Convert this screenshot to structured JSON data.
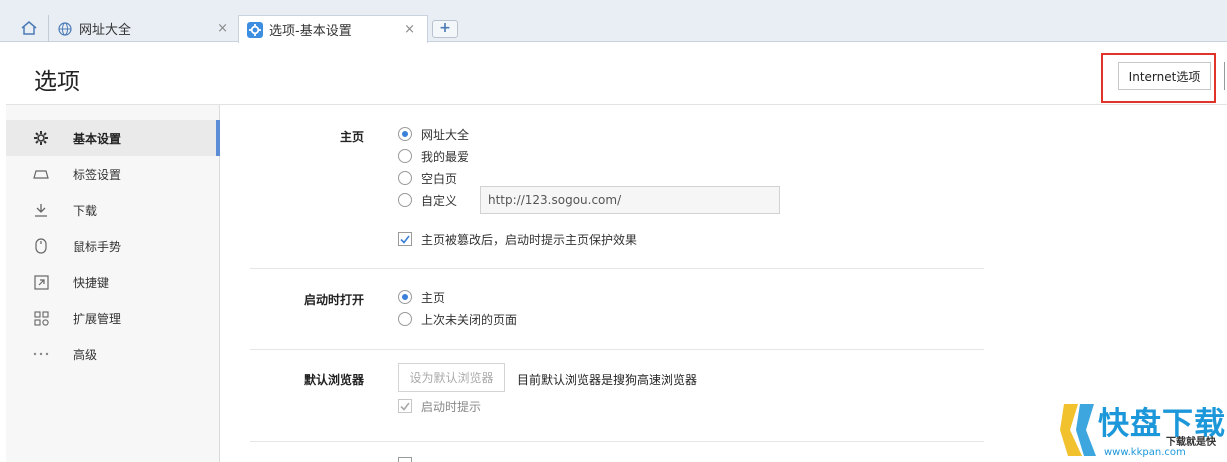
{
  "tabs": {
    "tab1_label": "网址大全",
    "tab2_label": "选项-基本设置",
    "close_glyph": "×",
    "new_tab_glyph": "+"
  },
  "header": {
    "title": "选项",
    "internet_options_label": "Internet选项"
  },
  "sidebar": {
    "items": [
      {
        "label": "基本设置",
        "icon": "gear-icon",
        "active": true
      },
      {
        "label": "标签设置",
        "icon": "tab-icon",
        "active": false
      },
      {
        "label": "下载",
        "icon": "download-icon",
        "active": false
      },
      {
        "label": "鼠标手势",
        "icon": "mouse-icon",
        "active": false
      },
      {
        "label": "快捷键",
        "icon": "shortcut-icon",
        "active": false
      },
      {
        "label": "扩展管理",
        "icon": "extensions-icon",
        "active": false
      },
      {
        "label": "高级",
        "icon": "more-icon",
        "active": false
      }
    ]
  },
  "homepage": {
    "label": "主页",
    "options": [
      "网址大全",
      "我的最爱",
      "空白页",
      "自定义"
    ],
    "selected": "网址大全",
    "custom_url": "http://123.sogou.com/",
    "protect_checkbox_label": "主页被篡改后，启动时提示主页保护效果",
    "protect_checked": true
  },
  "startup": {
    "label": "启动时打开",
    "options": [
      "主页",
      "上次未关闭的页面"
    ],
    "selected": "主页"
  },
  "default_browser": {
    "label": "默认浏览器",
    "button_label": "设为默认浏览器",
    "status": "目前默认浏览器是搜狗高速浏览器",
    "prompt_label": "启动时提示",
    "prompt_checked": true
  },
  "watermark": {
    "title": "快盘下载",
    "subtitle": "下载就是快",
    "url": "www.kkpan.com"
  },
  "colors": {
    "accent": "#3a7fd8",
    "highlight": "#e2332b",
    "watermark_blue": "#1c97d9"
  }
}
